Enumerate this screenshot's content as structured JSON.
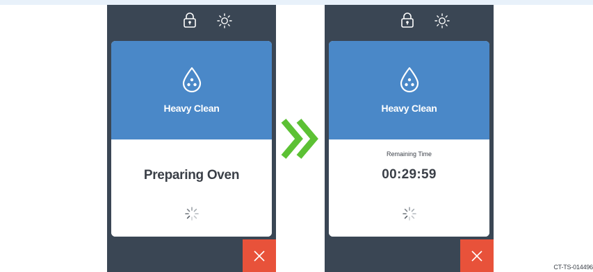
{
  "screens": [
    {
      "mode_title": "Heavy Clean",
      "status_text": "Preparing Oven",
      "icons": [
        "lock-icon",
        "brightness-icon",
        "water-drop-icon",
        "loading-spinner-icon",
        "close-icon"
      ]
    },
    {
      "mode_title": "Heavy Clean",
      "remaining_label": "Remaining Time",
      "remaining_time": "00:29:59",
      "icons": [
        "lock-icon",
        "brightness-icon",
        "water-drop-icon",
        "loading-spinner-icon",
        "close-icon"
      ]
    }
  ],
  "transition_icon": "double-chevron-right-icon",
  "reference_code": "CT-TS-014496",
  "colors": {
    "screen_bg": "#3a4654",
    "header_blue": "#4a88c8",
    "cancel_red": "#e8523a",
    "arrow_green": "#5cc134",
    "text_dark": "#3a3f47"
  }
}
